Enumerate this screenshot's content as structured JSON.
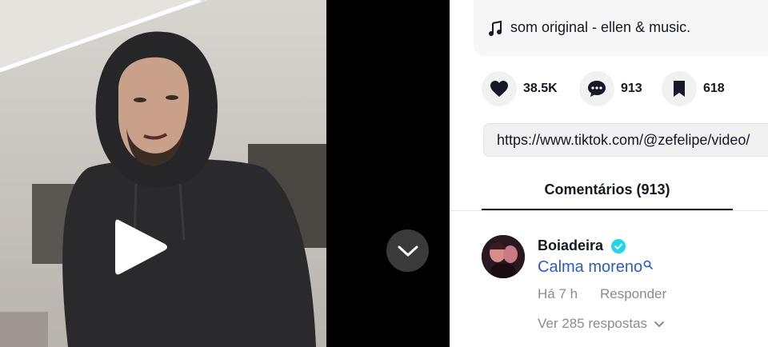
{
  "music": {
    "icon": "music-note-icon",
    "title": "som original - ellen & music."
  },
  "actions": {
    "likes": {
      "icon": "heart-icon",
      "count": "38.5K"
    },
    "comments": {
      "icon": "comment-icon",
      "count": "913"
    },
    "saves": {
      "icon": "bookmark-icon",
      "count": "618"
    }
  },
  "share": {
    "url": "https://www.tiktok.com/@zefelipe/video/"
  },
  "tabs": [
    {
      "label": "Comentários (913)",
      "active": true
    }
  ],
  "comments": [
    {
      "username": "Boiadeira",
      "verified": true,
      "text": "Calma moreno",
      "time": "Há 7 h",
      "reply_label": "Responder",
      "view_replies": "Ver 285 respostas"
    }
  ],
  "colors": {
    "link_blue": "#2b5db9",
    "verified": "#20d5ec",
    "muted": "#8a8b91",
    "text": "#161823"
  }
}
